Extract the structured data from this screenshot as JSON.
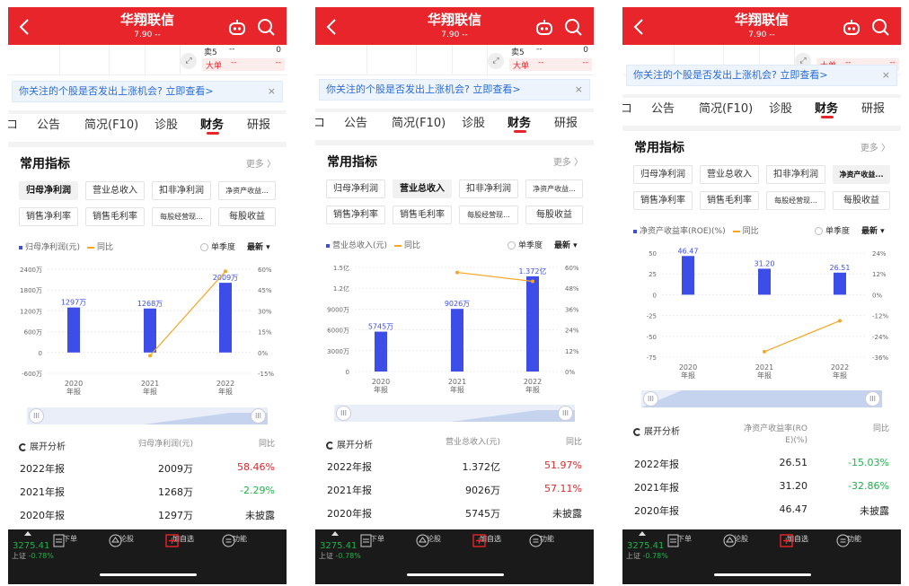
{
  "screens": [
    {
      "header": {
        "title": "华翔联信",
        "price": "7.90 --"
      },
      "quote": {
        "sell5_label": "卖5",
        "sell5_value": "--",
        "sell5_num": "0",
        "big_label": "大单",
        "big_value": "--",
        "big_num": "--"
      },
      "banner": {
        "text": "你关注的个股是否发出上涨机会? 立即查看>",
        "close": "×"
      },
      "tabs": [
        {
          "label": "コ"
        },
        {
          "label": "公告"
        },
        {
          "label": "简况(F10)"
        },
        {
          "label": "诊股"
        },
        {
          "label": "财务"
        },
        {
          "label": "研报"
        }
      ],
      "active_tab": "财务",
      "section": {
        "title": "常用指标",
        "more": "更多 〉"
      },
      "chips": [
        {
          "label": "归母净利润",
          "selected": true
        },
        {
          "label": "营业总收入",
          "selected": false
        },
        {
          "label": "扣非净利润",
          "selected": false
        },
        {
          "label": "净资产收益...",
          "selected": false
        },
        {
          "label": "销售净利率",
          "selected": false
        },
        {
          "label": "销售毛利率",
          "selected": false
        },
        {
          "label": "每股经营现...",
          "selected": false
        },
        {
          "label": "每股收益",
          "selected": false
        }
      ],
      "legend": {
        "series": "归母净利润(元)",
        "line": "同比"
      },
      "toggle": {
        "single": "单季度",
        "latest": "最新 ▾"
      },
      "chart_data": {
        "type": "bar",
        "categories": [
          "2020\n年报",
          "2021\n年报",
          "2022\n年报"
        ],
        "series": [
          {
            "name": "归母净利润(元)",
            "values": [
              1297,
              1268,
              2009
            ],
            "labels": [
              "1297万",
              "1268万",
              "2009万"
            ]
          }
        ],
        "line": {
          "name": "同比",
          "values": [
            null,
            -2.29,
            58.46
          ]
        },
        "left_ticks": [
          "2400万",
          "1800万",
          "1200万",
          "600万",
          "0",
          "-600万"
        ],
        "right_ticks": [
          "60%",
          "45%",
          "30%",
          "15%",
          "0%",
          "-15%"
        ],
        "ylim": [
          -600,
          2400
        ],
        "y2lim": [
          -15,
          60
        ]
      },
      "analysis": {
        "label": "展开分析",
        "col1": "归母净利润(元)",
        "col2": "同比"
      },
      "rows": [
        {
          "year": "2022年报",
          "value": "2009万",
          "pct": "58.46%",
          "color": "#e8252a"
        },
        {
          "year": "2021年报",
          "value": "1268万",
          "pct": "-2.29%",
          "color": "#20b14a"
        },
        {
          "year": "2020年报",
          "value": "1297万",
          "pct": "未披露",
          "color": "#222222"
        }
      ],
      "bottom": {
        "index": "3275.41",
        "index_label": "上证",
        "index_change": "-0.78%",
        "items": [
          {
            "label": "下单"
          },
          {
            "label": "论股"
          },
          {
            "label": "加自选"
          },
          {
            "label": "功能"
          }
        ]
      }
    },
    {
      "header": {
        "title": "华翔联信",
        "price": "7.90 --"
      },
      "quote": {
        "sell5_label": "卖5",
        "sell5_value": "--",
        "sell5_num": "0",
        "big_label": "大单",
        "big_value": "--",
        "big_num": "--"
      },
      "banner": {
        "text": "你关注的个股是否发出上涨机会? 立即查看>",
        "close": "×"
      },
      "tabs": [
        {
          "label": "コ"
        },
        {
          "label": "公告"
        },
        {
          "label": "简况(F10)"
        },
        {
          "label": "诊股"
        },
        {
          "label": "财务"
        },
        {
          "label": "研报"
        }
      ],
      "active_tab": "财务",
      "section": {
        "title": "常用指标",
        "more": "更多 〉"
      },
      "chips": [
        {
          "label": "归母净利润",
          "selected": false
        },
        {
          "label": "营业总收入",
          "selected": true
        },
        {
          "label": "扣非净利润",
          "selected": false
        },
        {
          "label": "净资产收益...",
          "selected": false
        },
        {
          "label": "销售净利率",
          "selected": false
        },
        {
          "label": "销售毛利率",
          "selected": false
        },
        {
          "label": "每股经营现...",
          "selected": false
        },
        {
          "label": "每股收益",
          "selected": false
        }
      ],
      "legend": {
        "series": "营业总收入(元)",
        "line": "同比"
      },
      "toggle": {
        "single": "单季度",
        "latest": "最新 ▾"
      },
      "chart_data": {
        "type": "bar",
        "categories": [
          "2020\n年报",
          "2021\n年报",
          "2022\n年报"
        ],
        "series": [
          {
            "name": "营业总收入(元)",
            "values": [
              5745,
              9026,
              13720
            ],
            "labels": [
              "5745万",
              "9026万",
              "1.372亿"
            ]
          }
        ],
        "line": {
          "name": "同比",
          "values": [
            null,
            57.11,
            51.97
          ]
        },
        "left_ticks": [
          "1.5亿",
          "1.2亿",
          "9000万",
          "6000万",
          "3000万",
          "0"
        ],
        "right_ticks": [
          "60%",
          "48%",
          "36%",
          "24%",
          "12%",
          "0%"
        ],
        "ylim": [
          0,
          15000
        ],
        "y2lim": [
          0,
          60
        ]
      },
      "analysis": {
        "label": "展开分析",
        "col1": "营业总收入(元)",
        "col2": "同比"
      },
      "rows": [
        {
          "year": "2022年报",
          "value": "1.372亿",
          "pct": "51.97%",
          "color": "#e8252a"
        },
        {
          "year": "2021年报",
          "value": "9026万",
          "pct": "57.11%",
          "color": "#e8252a"
        },
        {
          "year": "2020年报",
          "value": "5745万",
          "pct": "未披露",
          "color": "#222222"
        }
      ],
      "bottom": {
        "index": "3275.41",
        "index_label": "上证",
        "index_change": "-0.78%",
        "items": [
          {
            "label": "下单"
          },
          {
            "label": "论股"
          },
          {
            "label": "加自选"
          },
          {
            "label": "功能"
          }
        ]
      }
    },
    {
      "header": {
        "title": "华翔联信",
        "price": "7.90 --"
      },
      "quote": {
        "sell5_label": "",
        "sell5_value": "",
        "sell5_num": "",
        "big_label": "大单",
        "big_value": "--",
        "big_num": "--"
      },
      "banner": {
        "text": "你关注的个股是否发出上涨机会? 立即查看>",
        "close": "×"
      },
      "tabs": [
        {
          "label": "コ"
        },
        {
          "label": "公告"
        },
        {
          "label": "简况(F10)"
        },
        {
          "label": "诊股"
        },
        {
          "label": "财务"
        },
        {
          "label": "研报"
        }
      ],
      "active_tab": "财务",
      "section": {
        "title": "常用指标",
        "more": "更多 〉"
      },
      "chips": [
        {
          "label": "归母净利润",
          "selected": false
        },
        {
          "label": "营业总收入",
          "selected": false
        },
        {
          "label": "扣非净利润",
          "selected": false
        },
        {
          "label": "净资产收益...",
          "selected": true
        },
        {
          "label": "销售净利率",
          "selected": false
        },
        {
          "label": "销售毛利率",
          "selected": false
        },
        {
          "label": "每股经营现...",
          "selected": false
        },
        {
          "label": "每股收益",
          "selected": false
        }
      ],
      "legend": {
        "series": "净资产收益率(ROE)(%)",
        "line": "同比"
      },
      "toggle": {
        "single": "单季度",
        "latest": "最新 ▾"
      },
      "chart_data": {
        "type": "bar",
        "categories": [
          "2020\n年报",
          "2021\n年报",
          "2022\n年报"
        ],
        "series": [
          {
            "name": "净资产收益率(ROE)(%)",
            "values": [
              46.47,
              31.2,
              26.51
            ],
            "labels": [
              "46.47",
              "31.20",
              "26.51"
            ]
          }
        ],
        "line": {
          "name": "同比",
          "values": [
            null,
            -32.86,
            -15.03
          ]
        },
        "left_ticks": [
          "50",
          "25",
          "0",
          "-25",
          "-50",
          "-75"
        ],
        "right_ticks": [
          "24%",
          "12%",
          "0%",
          "-12%",
          "-24%",
          "-36%"
        ],
        "ylim": [
          -75,
          50
        ],
        "y2lim": [
          -36,
          24
        ]
      },
      "analysis": {
        "label": "展开分析",
        "col1": "净资产收益率(ROE)(%)",
        "col2": "同比"
      },
      "rows": [
        {
          "year": "2022年报",
          "value": "26.51",
          "pct": "-15.03%",
          "color": "#20b14a"
        },
        {
          "year": "2021年报",
          "value": "31.20",
          "pct": "-32.86%",
          "color": "#20b14a"
        },
        {
          "year": "2020年报",
          "value": "46.47",
          "pct": "未披露",
          "color": "#222222"
        }
      ],
      "bottom": {
        "index": "3275.41",
        "index_label": "上证",
        "index_change": "-0.78%",
        "items": [
          {
            "label": "下单"
          },
          {
            "label": "论股"
          },
          {
            "label": "加自选"
          },
          {
            "label": "功能"
          }
        ]
      }
    }
  ]
}
